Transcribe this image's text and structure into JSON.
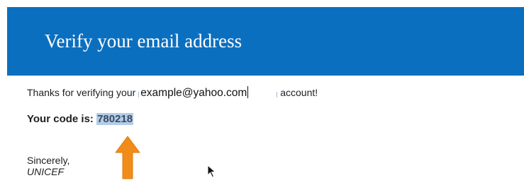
{
  "email_header": {
    "title": "Verify your email address"
  },
  "message": {
    "thanks_prefix": "Thanks for verifying your",
    "email": "example@yahoo.com",
    "thanks_suffix": "account!",
    "code_label": "Your code is:",
    "code_value": "780218",
    "closing": "Sincerely,",
    "sender": "UNICEF"
  },
  "colors": {
    "header_background": "#0b6fbf",
    "code_highlight": "#b3cde7",
    "arrow": "#f28c18"
  },
  "icons": {
    "arrow": "arrow-up-icon",
    "cursor": "mouse-cursor-icon"
  }
}
